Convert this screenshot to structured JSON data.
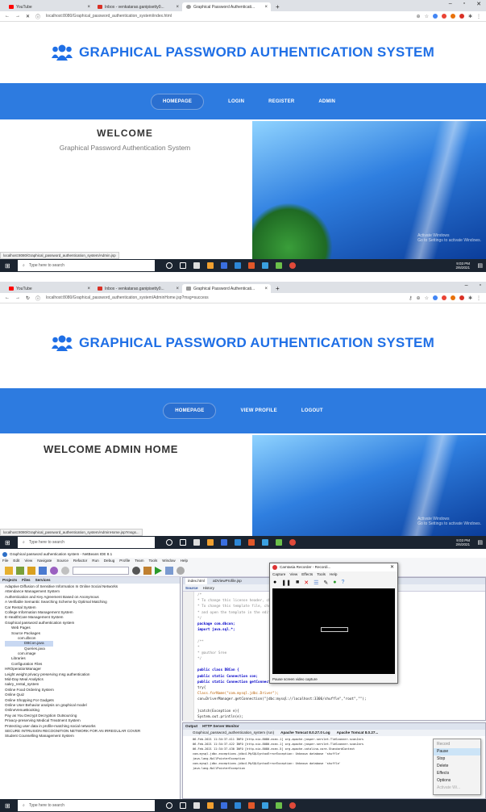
{
  "screen1": {
    "tabs": [
      {
        "label": "YouTube",
        "color": "#ff0000"
      },
      {
        "label": "Inbox - venkatarao.ganipisetty0...",
        "color": "#d93025"
      },
      {
        "label": "Graphical Password Authenticati...",
        "color": "#999999"
      }
    ],
    "url": "localhost:8080/Graphical_password_authentication_system/index.html",
    "brand": "GRAPHICAL PASSWORD AUTHENTICATION SYSTEM",
    "nav": [
      "HOMEPAGE",
      "LOGIN",
      "REGISTER",
      "ADMIN"
    ],
    "welcome_title": "WELCOME",
    "welcome_sub": "Graphical Password Authentication System",
    "status_url": "localhost:8080/Graphical_password_authentication_system/Admin.jsp",
    "activation": [
      "Activate Windows",
      "Go to Settings to activate Windows."
    ],
    "taskbar": {
      "search": "Type here to search",
      "time": "9:03 PM",
      "date": "2/6/2021"
    }
  },
  "screen2": {
    "tabs": [
      {
        "label": "YouTube",
        "color": "#ff0000"
      },
      {
        "label": "Inbox - venkatarao.ganipisetty0...",
        "color": "#d93025"
      },
      {
        "label": "Graphical Password Authenticati...",
        "color": "#999999"
      }
    ],
    "url": "localhost:8080/Graphical_password_authentication_system/AdminHome.jsp?msg=success",
    "brand": "GRAPHICAL PASSWORD AUTHENTICATION SYSTEM",
    "nav": [
      "HOMEPAGE",
      "VIEW PROFILE",
      "LOGOUT"
    ],
    "welcome_title": "WELCOME ADMIN HOME",
    "status_url": "localhost:8080/Graphical_password_authentication_system/AdminHome.jsp?msgs...",
    "activation": [
      "Activate Windows",
      "Go to Settings to activate Windows."
    ],
    "taskbar": {
      "search": "Type here to search",
      "time": "9:03 PM",
      "date": "2/6/2021"
    }
  },
  "screen3": {
    "title": "Graphical password authentication system - NetBeans IDE 8.1",
    "menu": [
      "File",
      "Edit",
      "View",
      "Navigate",
      "Source",
      "Refactor",
      "Run",
      "Debug",
      "Profile",
      "Team",
      "Tools",
      "Window",
      "Help"
    ],
    "project_tabs": [
      "Projects",
      "Files",
      "Services"
    ],
    "projects": [
      "Adaptive Diffusion of Sensitive Information In Online Social Networks",
      "Attendance Management System",
      "Authentication and Key Agreement Based on Anonymous",
      "A Verifiable Semantic Searching Scheme by Optimal Matching",
      "Car Rental System",
      "College Information Management System",
      "E-HealthCare Management System",
      "Graphical password authentication system",
      "Web Pages",
      "Source Packages",
      "com.dbcon",
      "DBCon.java",
      "Queries.java",
      "com.image",
      "Libraries",
      "Configuration Files",
      "HROperationManager",
      "Leight weight privacy preserving msg authentication",
      "Mid-Day Meal Analytics",
      "nakry_rental_system",
      "Online Food Ordering System",
      "Online Quiz",
      "Online Shopping For Gadgets",
      "Online User Behavior analysis on graphical model",
      "OnlineVenueBooking",
      "Pay as You Decrypt Decryption Outsourcing",
      "Privacy-preserving Medical Treatment System",
      "Protecting user data in profile-matching social networks",
      "SECURE INTRUSION RECOGNITION NETWORK FOR AN IRREGULAR COVER",
      "Student Counselling Management System"
    ],
    "editor_tabs": [
      "index.html",
      "aDViewProfile.jsp"
    ],
    "editor_toolbar": [
      "Source",
      "History"
    ],
    "code": [
      "/*",
      " * To change this license header, choose License Headers in Project Properties.",
      " * To change this template file, choose Tools | Templates",
      " * and open the template in the editor.",
      " */",
      "package com.dbcon;",
      "import java.sql.*;",
      "",
      "/**",
      " *",
      " * @author Sree",
      " */",
      "",
      "public class DBCon {",
      "    public static Connection con;",
      "    public static Connection getConnection(){",
      "    try{",
      "    Class.forName(\"com.mysql.jdbc.Driver\");",
      "    con=DriverManager.getConnection(\"jdbc:mysql://localhost:3306/shuffle\",\"root\",\"\");",
      "",
      "    }catch(Exception e){",
      "        System.out.println(e);"
    ],
    "camtasia": {
      "title": "Camtasia Recorder - Recordi...",
      "menu": [
        "Capture",
        "View",
        "Effects",
        "Tools",
        "Help"
      ],
      "status": "Pause screen video capture"
    },
    "output_tabs": [
      "Output",
      "HTTP Server Monitor"
    ],
    "output_subtabs": [
      "Graphical_password_authentication_system (run)",
      "Apache Tomcat 8.0.27.0 Log",
      "Apache Tomcat 8.0.27..."
    ],
    "output_lines": [
      "06-Feb-2021 11:34:37.411 INFO [http-nio-8080-exec-1] org.apache.jasper.servlet.TldScanner.scanJars",
      "06-Feb-2021 11:34:37.422 INFO [http-nio-8080-exec-1] org.apache.jasper.servlet.TldScanner.scanJars",
      "06-Feb-2021 11:34:37.430 INFO [http-nio-8080-exec-5] org.apache.catalina.core.StandardContext",
      "com.mysql.jdbc.exceptions.jdbc4.MySQLSyntaxErrorException: Unknown database 'shuffle'",
      "java.lang.NullPointerException",
      "com.mysql.jdbc.exceptions.jdbc4.MySQLSyntaxErrorException: Unknown database 'shuffle'",
      "java.lang.NullPointerException"
    ],
    "context_menu": [
      "Record",
      "Pause",
      "Stop",
      "Delete",
      "Effects",
      "Options",
      "Activate Wi..."
    ],
    "taskbar": {
      "search": "Type here to search"
    }
  }
}
